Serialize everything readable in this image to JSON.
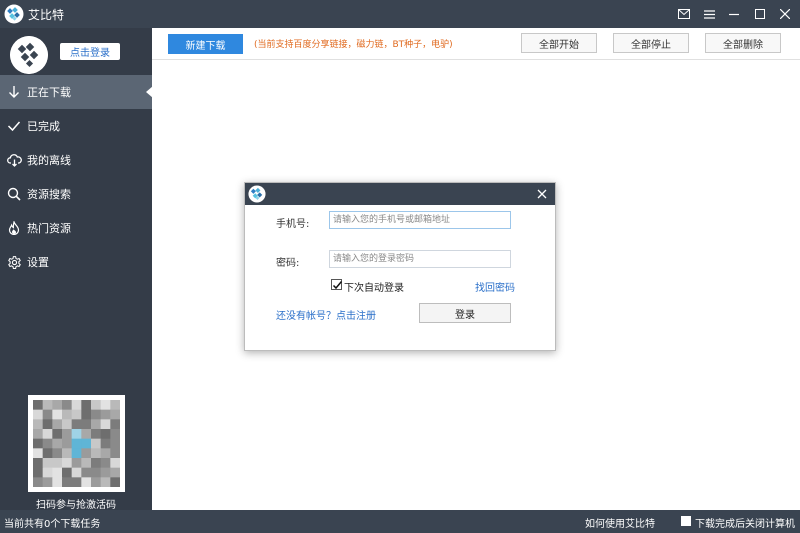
{
  "app": {
    "title": "艾比特",
    "logo_icon": "app-logo-icon"
  },
  "window_controls": [
    {
      "name": "mail-icon",
      "label": "mail"
    },
    {
      "name": "menu-icon",
      "label": "menu"
    },
    {
      "name": "minimize-icon",
      "label": "minimize"
    },
    {
      "name": "maximize-icon",
      "label": "maximize"
    },
    {
      "name": "close-icon",
      "label": "close"
    }
  ],
  "sidebar": {
    "login_label": "点击登录",
    "items": [
      {
        "label": "正在下载",
        "icon": "download-arrow-icon",
        "active": true
      },
      {
        "label": "已完成",
        "icon": "checkmark-icon",
        "active": false
      },
      {
        "label": "我的离线",
        "icon": "cloud-icon",
        "active": false
      },
      {
        "label": "资源搜索",
        "icon": "search-icon",
        "active": false
      },
      {
        "label": "热门资源",
        "icon": "flame-icon",
        "active": false
      },
      {
        "label": "设置",
        "icon": "gear-icon",
        "active": false
      }
    ],
    "qr_caption": "扫码参与抢激活码"
  },
  "toolbar": {
    "new_download": "新建下载",
    "tip": "(当前支持百度分享链接，磁力链，BT种子，电驴)",
    "start_all": "全部开始",
    "stop_all": "全部停止",
    "delete_all": "全部删除"
  },
  "status": {
    "task_count": "当前共有0个下载任务",
    "how_to": "如何使用艾比特",
    "shutdown_label": "下载完成后关闭计算机"
  },
  "login_dialog": {
    "phone_label": "手机号:",
    "phone_placeholder": "请输入您的手机号或邮箱地址",
    "password_label": "密码:",
    "password_placeholder": "请输入您的登录密码",
    "auto_login_label": "下次自动登录",
    "auto_login_checked": true,
    "forgot_password": "找回密码",
    "register": "还没有帐号？点击注册",
    "login_button": "登录"
  },
  "colors": {
    "titlebar": "#3a4451",
    "sidebar": "#343c48",
    "sidebar_active": "#5b6674",
    "accent_blue": "#2f88df",
    "tip_orange": "#e06a1f",
    "link_blue": "#2a6fc9"
  }
}
